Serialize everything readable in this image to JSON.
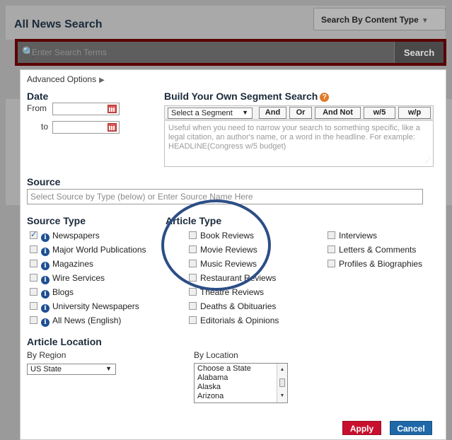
{
  "header": {
    "title": "All News Search",
    "content_type_button": "Search By Content Type"
  },
  "search": {
    "placeholder": "Enter Search Terms",
    "button": "Search"
  },
  "advanced_options": {
    "label": "Advanced Options"
  },
  "date": {
    "heading": "Date",
    "from_label": "From",
    "to_label": "to"
  },
  "segment": {
    "heading": "Build Your Own Segment Search",
    "select_label": "Select a Segment",
    "operators": [
      "And",
      "Or",
      "And Not",
      "w/5",
      "w/p"
    ],
    "help_text": "Useful when you need to narrow your search to something specific, like a legal citation, an author's name, or a word in the headline. For example: HEADLINE(Congress w/5 budget)"
  },
  "source": {
    "heading": "Source",
    "placeholder": "Select Source by Type (below) or Enter Source Name Here"
  },
  "source_type": {
    "heading": "Source Type",
    "items": [
      {
        "label": "Newspapers",
        "checked": true
      },
      {
        "label": "Major World Publications",
        "checked": false
      },
      {
        "label": "Magazines",
        "checked": false
      },
      {
        "label": "Wire Services",
        "checked": false
      },
      {
        "label": "Blogs",
        "checked": false
      },
      {
        "label": "University Newspapers",
        "checked": false
      },
      {
        "label": "All News (English)",
        "checked": false
      }
    ]
  },
  "article_type": {
    "heading": "Article Type",
    "col1": [
      "Book Reviews",
      "Movie Reviews",
      "Music Reviews",
      "Restaurant Reviews",
      "Theatre Reviews",
      "Deaths & Obituaries",
      "Editorials & Opinions"
    ],
    "col2": [
      "Interviews",
      "Letters & Comments",
      "Profiles & Biographies"
    ]
  },
  "article_location": {
    "heading": "Article Location",
    "by_region_label": "By Region",
    "region_value": "US State",
    "by_location_label": "By Location",
    "locations": [
      "Choose a State",
      "Alabama",
      "Alaska",
      "Arizona"
    ]
  },
  "actions": {
    "apply": "Apply",
    "cancel": "Cancel"
  },
  "colors": {
    "apply": "#c8102e",
    "cancel": "#1f68a8",
    "highlight_circle": "#2c4e86",
    "search_border": "#5a0000"
  }
}
